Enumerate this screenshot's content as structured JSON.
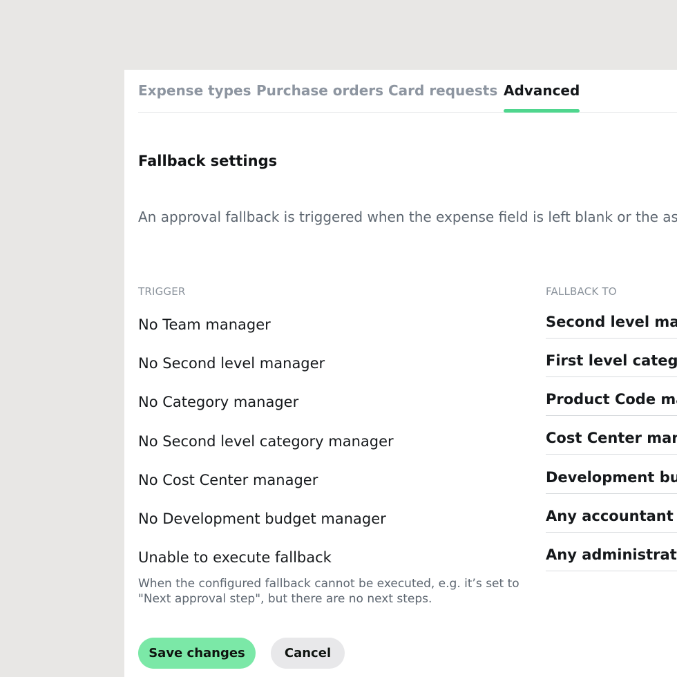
{
  "tabs": [
    {
      "label": "Expense types"
    },
    {
      "label": "Purchase orders"
    },
    {
      "label": "Card requests"
    },
    {
      "label": "Advanced",
      "active": true
    }
  ],
  "section": {
    "title": "Fallback settings",
    "description": "An approval fallback is triggered when the expense field is left blank or the ass"
  },
  "columns": {
    "trigger": "TRIGGER",
    "fallback_to": "FALLBACK TO"
  },
  "rows": [
    {
      "trigger": "No Team manager",
      "fallback": "Second level man"
    },
    {
      "trigger": "No Second level manager",
      "fallback": "First level categor"
    },
    {
      "trigger": "No Category manager",
      "fallback": "Product Code mar"
    },
    {
      "trigger": "No Second level category manager",
      "fallback": "Cost Center manc"
    },
    {
      "trigger": "No Cost Center manager",
      "fallback": "Development bud"
    },
    {
      "trigger": "No Development budget manager",
      "fallback": "Any accountant"
    },
    {
      "trigger": "Unable to execute fallback",
      "fallback": "Any administrator"
    }
  ],
  "note": "When the configured fallback cannot be executed, e.g. it’s set to \"Next approval step\", but there are no next steps.",
  "buttons": {
    "save": "Save changes",
    "cancel": "Cancel"
  },
  "colors": {
    "accent": "#4fd68e",
    "save_button": "#7be8a7",
    "background": "#e8e7e5"
  }
}
